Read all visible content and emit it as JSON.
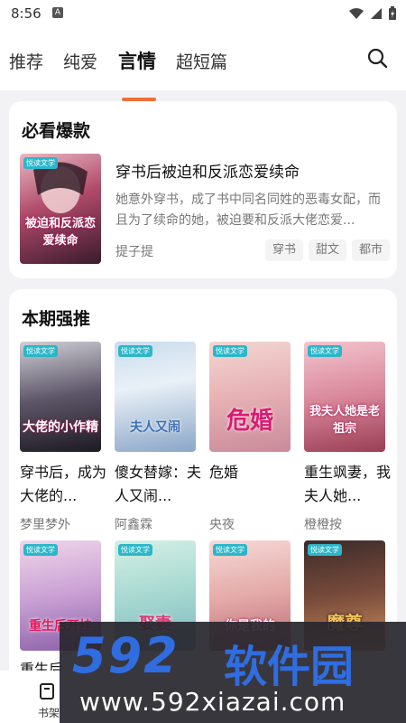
{
  "status": {
    "time": "8:56",
    "app_icon": "A"
  },
  "tabs": [
    {
      "label": "推荐"
    },
    {
      "label": "纯爱"
    },
    {
      "label": "言情"
    },
    {
      "label": "超短篇"
    }
  ],
  "active_tab": "言情",
  "featured": {
    "heading": "必看爆款",
    "book": {
      "title": "穿书后被迫和反派恋爱续命",
      "description": "她意外穿书，成了书中同名同姓的恶毒女配，而且为了续命的她，被迫要和反派大佬恋爱...",
      "author": "提子提",
      "tags": [
        "穿书",
        "甜文",
        "都市"
      ],
      "cover_text": "被迫和反派恋爱续命"
    }
  },
  "weekly": {
    "heading": "本期强推",
    "books": [
      {
        "title": "穿书后，成为大佬的...",
        "author": "梦里梦外",
        "cover_text": "大佬的小作精"
      },
      {
        "title": "傻女替嫁：夫人又闹...",
        "author": "阿鑫霖",
        "cover_text": "夫人又闹"
      },
      {
        "title": "危婚",
        "author": "央夜",
        "cover_text": "危婚"
      },
      {
        "title": "重生飒妻，我夫人她...",
        "author": "橙橙按",
        "cover_text": "我夫人她是老祖宗"
      }
    ],
    "row2": [
      {
        "cover_text": "重生后开挂",
        "partial_title": "重生后"
      },
      {
        "cover_text": "娶妻"
      },
      {
        "cover_text": "你是我的"
      },
      {
        "cover_text": "魔尊"
      }
    ]
  },
  "bottom_nav": {
    "item_label": "书架"
  },
  "watermark": {
    "brand": "592",
    "brand_cn": "软件园",
    "url": "www.592xiazai.com"
  },
  "colors": {
    "accent": "#f0703a",
    "cover_label": "#2bb6c9",
    "watermark_blue": "#2f6de0"
  },
  "cover_labels": "悦读文学"
}
